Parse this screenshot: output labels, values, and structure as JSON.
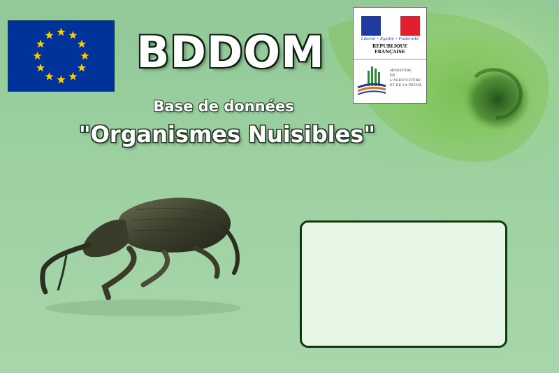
{
  "header": {
    "title": "BDDOM",
    "subtitle_line1": "Base de données",
    "subtitle_line2": "\"Organismes Nuisibles\""
  },
  "logos": {
    "eu_flag": {
      "icon": "eu-flag-icon",
      "background": "#003399",
      "star_color": "#ffcc00",
      "star_count": 12
    },
    "republique_francaise": {
      "motto": "Liberté • Égalité • Fraternité",
      "name": "RÉPUBLIQUE FRANÇAISE"
    },
    "ministere": {
      "line1": "MINISTÈRE",
      "line2": "DE L'AGRICULTURE",
      "line3": "ET DE LA PÊCHE"
    }
  },
  "colors": {
    "background": "#9acf9f",
    "panel_fill": "#e6f7e6",
    "panel_border": "#0e3a0e"
  },
  "images": {
    "insect": "weevil-photo",
    "leaf": "green-leaf-photo"
  }
}
